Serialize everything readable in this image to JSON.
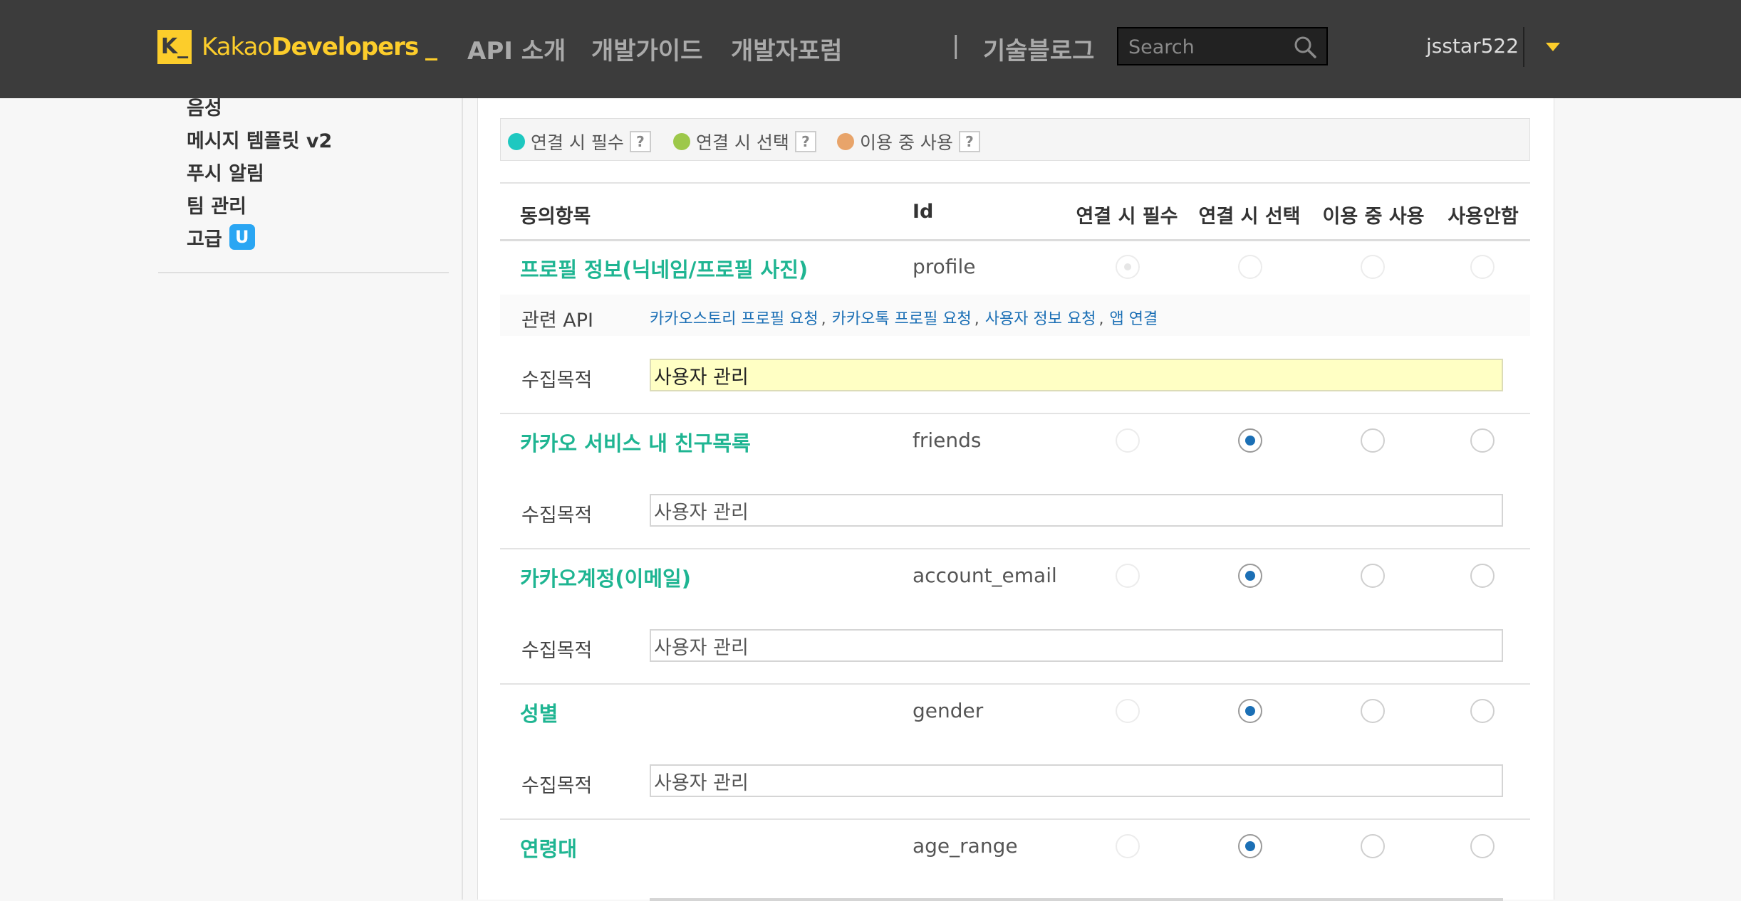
{
  "header": {
    "logo_mark": "K_",
    "logo_text_light": "Kakao",
    "logo_text_bold": "Developers",
    "logo_cursor": "_",
    "nav": [
      "API 소개",
      "개발가이드",
      "개발자포럼"
    ],
    "nav_separator": "|",
    "blog": "기술블로그",
    "search_placeholder": "Search",
    "username": "jsstar522"
  },
  "sidebar": {
    "items": [
      {
        "label": "음성"
      },
      {
        "label": "메시지 템플릿 v2"
      },
      {
        "label": "푸시 알림"
      },
      {
        "label": "팀 관리"
      },
      {
        "label": "고급",
        "badge": "U"
      }
    ]
  },
  "legend": {
    "items": [
      {
        "label": "연결 시 필수",
        "color": "#1ec8c0"
      },
      {
        "label": "연결 시 선택",
        "color": "#9dc84a"
      },
      {
        "label": "이용 중 사용",
        "color": "#e8a46a"
      }
    ],
    "help": "?"
  },
  "table": {
    "headers": [
      "동의항목",
      "Id",
      "연결 시 필수",
      "연결 시 선택",
      "이용 중 사용",
      "사용안함"
    ],
    "api_label": "관련 API",
    "api_links": [
      "카카오스토리 프로필 요청",
      "카카오톡 프로필 요청",
      "사용자 정보 요청",
      "앱 연결"
    ],
    "purpose_label": "수집목적",
    "rows": [
      {
        "name": "프로필 정보(닉네임/프로필 사진)",
        "id": "profile",
        "purpose": "사용자 관리",
        "selected": "연결 시 필수"
      },
      {
        "name": "카카오 서비스 내 친구목록",
        "id": "friends",
        "purpose": "사용자 관리",
        "selected": "연결 시 선택"
      },
      {
        "name": "카카오계정(이메일)",
        "id": "account_email",
        "purpose": "사용자 관리",
        "selected": "연결 시 선택"
      },
      {
        "name": "성별",
        "id": "gender",
        "purpose": "사용자 관리",
        "selected": "연결 시 선택"
      },
      {
        "name": "연령대",
        "id": "age_range",
        "purpose": "",
        "selected": "연결 시 선택"
      }
    ]
  },
  "colors": {
    "header_bg": "#3c3c3c",
    "brand_yellow": "#fccd2b",
    "item_green": "#1fb592",
    "link_blue": "#1b6fb5",
    "highlight_input": "#ffffc4"
  }
}
